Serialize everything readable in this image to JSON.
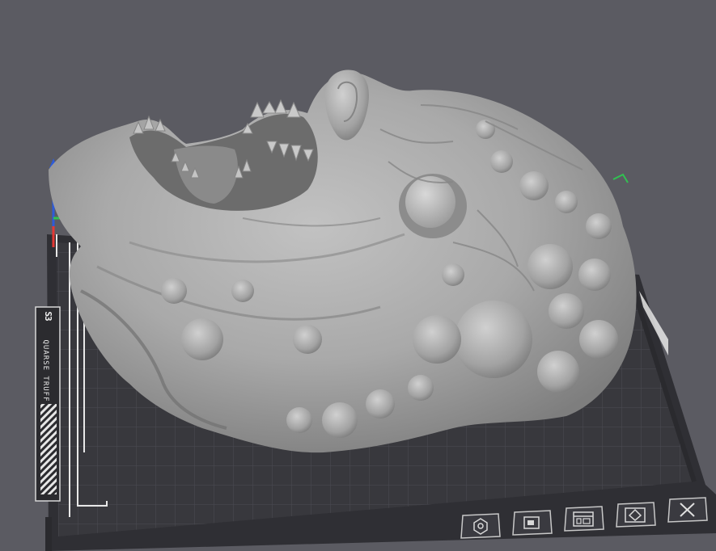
{
  "bed": {
    "logo_text": "S3",
    "name_text": "QUARSE TRUFF"
  },
  "toolbar": {
    "buttons": [
      {
        "icon": "orient-icon",
        "label": ""
      },
      {
        "icon": "layer-icon",
        "label": ""
      },
      {
        "icon": "arrange-icon",
        "label": ""
      },
      {
        "icon": "support-icon",
        "label": ""
      },
      {
        "icon": "close-icon",
        "label": ""
      }
    ]
  },
  "axes": {
    "x_color": "#e53935",
    "y_color": "#31c251",
    "z_color": "#2d5bd9"
  },
  "colors": {
    "background": "#5b5b62",
    "bed": "#333338",
    "grid": "#4b4b52",
    "model": "#a7a7a7"
  }
}
